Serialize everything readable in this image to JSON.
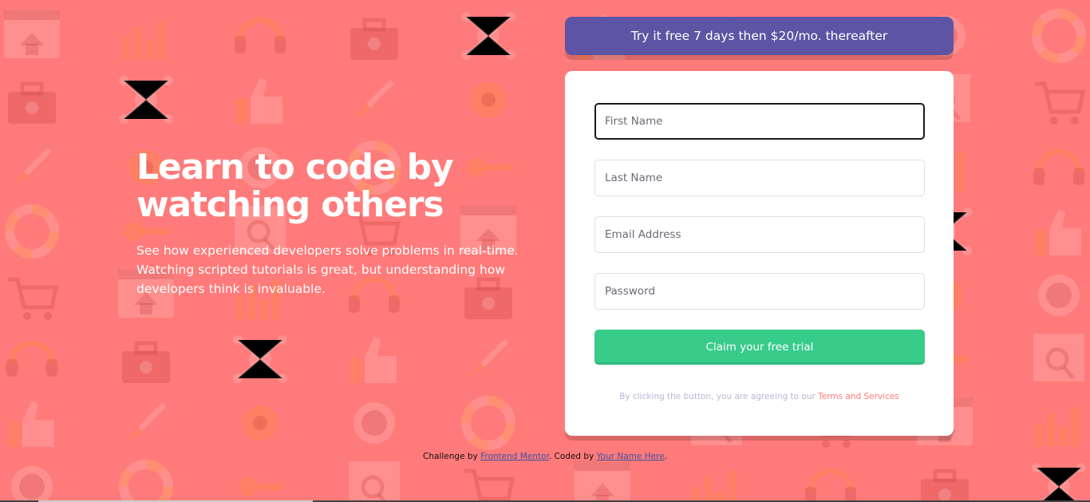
{
  "hero": {
    "headline": "Learn to code by watching others",
    "subtext": "See how experienced developers solve problems in real-time. Watching scripted tutorials is great, but understanding how developers think is invaluable."
  },
  "banner": {
    "text": "Try it free 7 days then $20/mo. thereafter"
  },
  "form": {
    "first_name_placeholder": "First Name",
    "last_name_placeholder": "Last Name",
    "email_placeholder": "Email Address",
    "password_placeholder": "Password",
    "submit_label": "Claim your free trial",
    "terms_prefix": "By clicking the button, you are agreeing to our ",
    "terms_link": "Terms and Services"
  },
  "attribution": {
    "prefix": "Challenge by ",
    "link1": "Frontend Mentor",
    "middle": ". Coded by ",
    "link2": "Your Name Here",
    "suffix": "."
  },
  "colors": {
    "background": "#ff7a7a",
    "banner": "#5e54a4",
    "button": "#38cc8b",
    "terms_link": "#ff7a7a"
  },
  "icons": [
    "browser-home-icon",
    "bar-chart-icon",
    "headset-icon",
    "toolbox-icon",
    "network-icon",
    "thumbs-up-icon",
    "rocket-icon",
    "gear-icon",
    "globe-icon",
    "lifebuoy-icon",
    "key-icon",
    "search-icon",
    "cart-icon"
  ]
}
